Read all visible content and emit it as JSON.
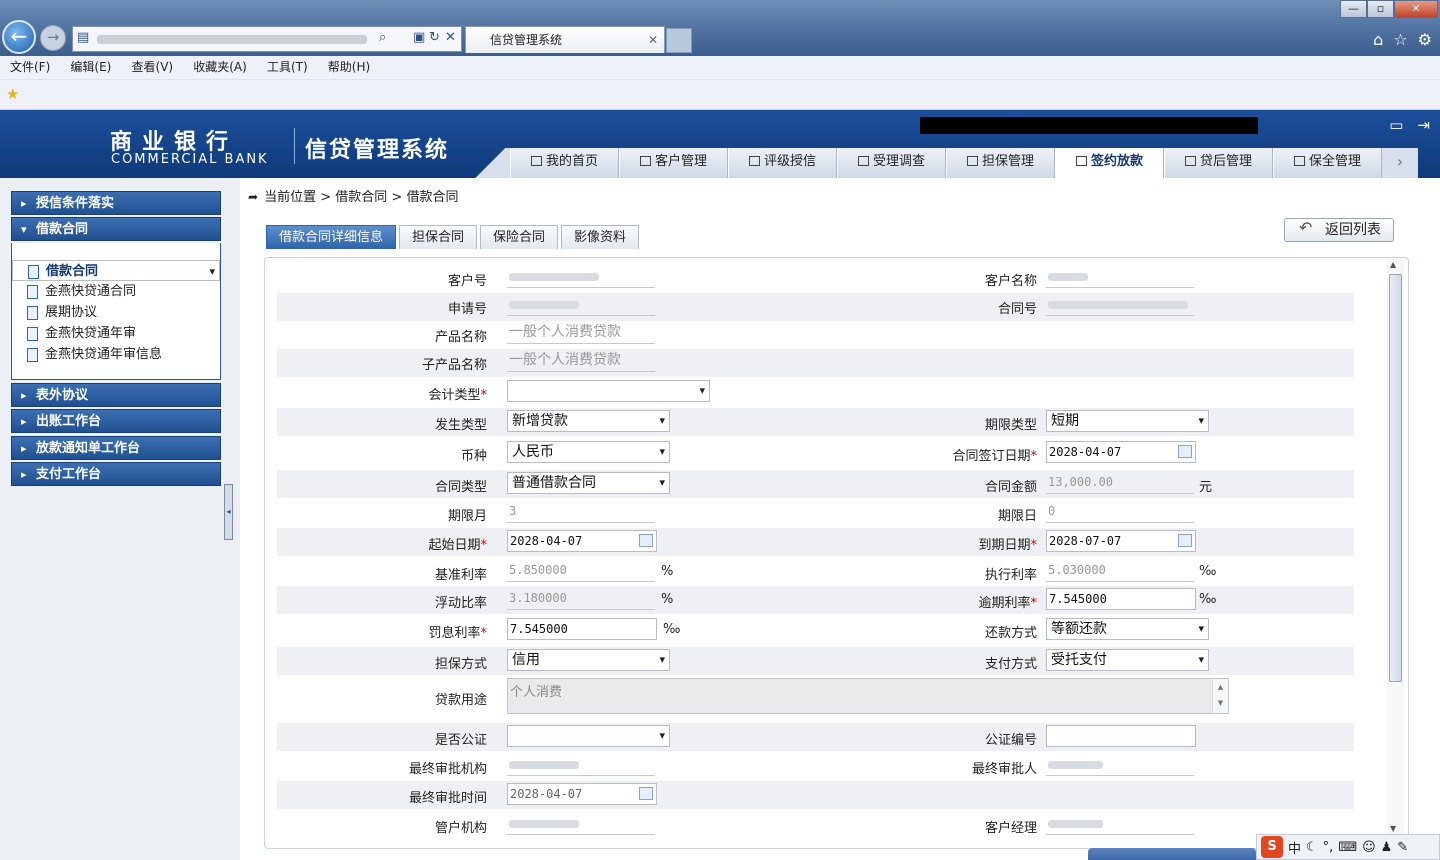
{
  "browser": {
    "tab_title": "信贷管理系统",
    "menu": [
      "文件(F)",
      "编辑(E)",
      "查看(V)",
      "收藏夹(A)",
      "工具(T)",
      "帮助(H)"
    ]
  },
  "header": {
    "bank_name_cn": "商业银行",
    "bank_name_en": "COMMERCIAL BANK",
    "system_title": "信贷管理系统"
  },
  "nav": {
    "tabs": [
      {
        "label": "我的首页",
        "icon": "home-icon"
      },
      {
        "label": "客户管理",
        "icon": "customer-icon"
      },
      {
        "label": "评级授信",
        "icon": "rating-icon"
      },
      {
        "label": "受理调查",
        "icon": "survey-icon"
      },
      {
        "label": "担保管理",
        "icon": "guarantee-icon"
      },
      {
        "label": "签约放款",
        "icon": "contract-icon"
      },
      {
        "label": "贷后管理",
        "icon": "postloan-icon"
      },
      {
        "label": "保全管理",
        "icon": "preservation-icon"
      }
    ],
    "active": "签约放款"
  },
  "sidebar": {
    "groups": {
      "g1": "授信条件落实",
      "g2": "借款合同",
      "g3": "表外协议",
      "g4": "出账工作台",
      "g5": "放款通知单工作台",
      "g6": "支付工作台"
    },
    "items": [
      "借款合同",
      "金燕快贷通合同",
      "展期协议",
      "金燕快贷通年审",
      "金燕快贷通年审信息"
    ],
    "selected": "借款合同"
  },
  "breadcrumb": {
    "prefix": "当前位置",
    "sep": ">",
    "level1": "借款合同",
    "level2": "借款合同"
  },
  "subtabs": [
    "借款合同详细信息",
    "担保合同",
    "保险合同",
    "影像资料"
  ],
  "back_button": "返回列表",
  "form": {
    "labels": {
      "customer_no": "客户号",
      "customer_name": "客户名称",
      "apply_no": "申请号",
      "contract_no": "合同号",
      "product_name": "产品名称",
      "sub_product_name": "子产品名称",
      "accounting_type": "会计类型",
      "occur_type": "发生类型",
      "term_type": "期限类型",
      "currency": "币种",
      "sign_date": "合同签订日期",
      "contract_type": "合同类型",
      "contract_amount": "合同金额",
      "term_month": "期限月",
      "term_day": "期限日",
      "start_date": "起始日期",
      "due_date": "到期日期",
      "base_rate": "基准利率",
      "exec_rate": "执行利率",
      "float_ratio": "浮动比率",
      "overdue_rate": "逾期利率",
      "penalty_rate": "罚息利率",
      "repay_method": "还款方式",
      "guarantee_method": "担保方式",
      "pay_method": "支付方式",
      "loan_purpose": "贷款用途",
      "notarized": "是否公证",
      "notary_no": "公证编号",
      "final_org": "最终审批机构",
      "final_person": "最终审批人",
      "final_time": "最终审批时间",
      "manage_org": "管户机构",
      "cust_manager": "客户经理"
    },
    "values": {
      "product_name": "一般个人消费贷款",
      "sub_product_name": "一般个人消费贷款",
      "accounting_type": "",
      "occur_type": "新增贷款",
      "term_type": "短期",
      "currency": "人民币",
      "sign_date": "2028-04-07",
      "contract_type": "普通借款合同",
      "contract_amount": "13,000.00",
      "term_month": "3",
      "term_day": "0",
      "start_date": "2028-04-07",
      "due_date": "2028-07-07",
      "base_rate": "5.850000",
      "exec_rate": "5.030000",
      "float_ratio": "3.180000",
      "overdue_rate": "7.545000",
      "penalty_rate": "7.545000",
      "repay_method": "等额还款",
      "guarantee_method": "信用",
      "pay_method": "受托支付",
      "loan_purpose": "个人消费",
      "notarized": "",
      "notary_no": "",
      "final_time": "2028-04-07"
    },
    "units": {
      "amount": "元",
      "percent": "%",
      "permille": "‰"
    }
  },
  "ime": {
    "lang": "中"
  }
}
